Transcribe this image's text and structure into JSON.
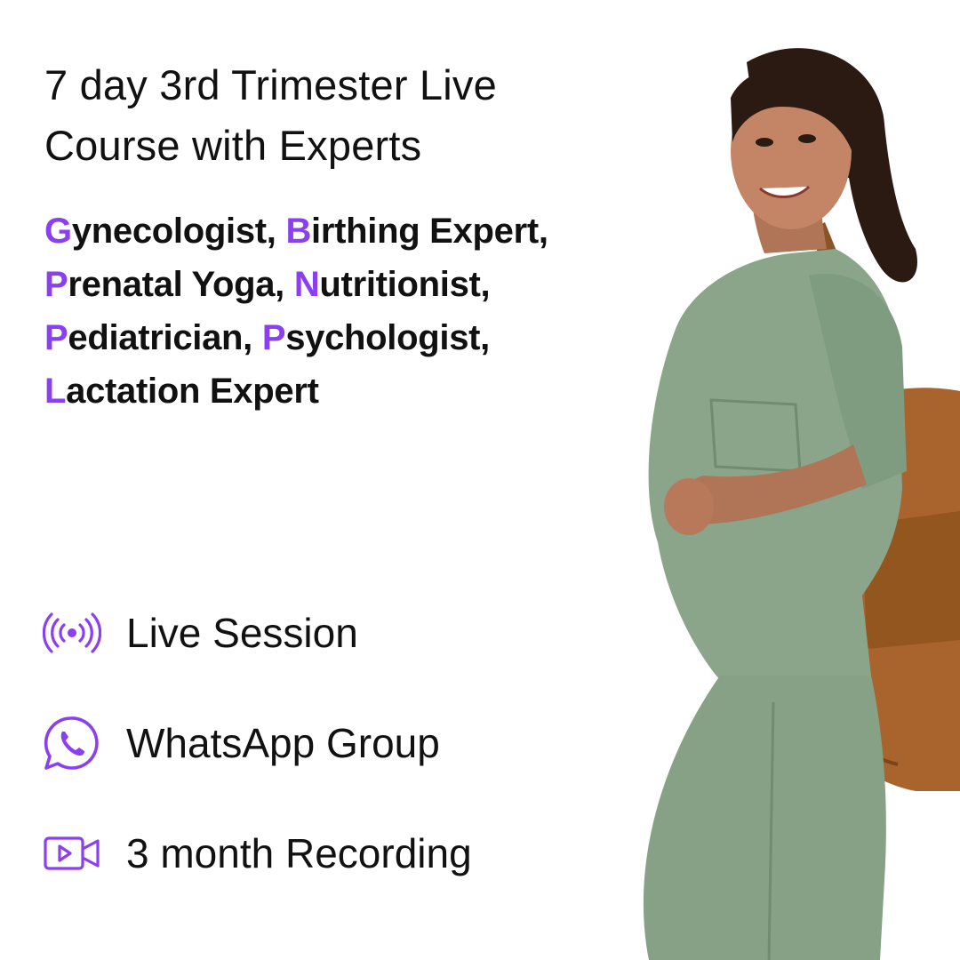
{
  "title": {
    "line1": "7 day 3rd Trimester Live",
    "line2": "Course with Experts"
  },
  "experts": [
    {
      "initial": "G",
      "rest": "ynecologist,"
    },
    {
      "initial": "B",
      "rest": "irthing Expert,"
    },
    {
      "initial": "P",
      "rest": "renatal Yoga,"
    },
    {
      "initial": "N",
      "rest": "utritionist,"
    },
    {
      "initial": "P",
      "rest": "ediatrician,"
    },
    {
      "initial": "P",
      "rest": "sychologist,"
    },
    {
      "initial": "L",
      "rest": "actation Expert"
    }
  ],
  "features": [
    {
      "label": "Live Session",
      "icon": "live-broadcast-icon"
    },
    {
      "label": "WhatsApp Group",
      "icon": "whatsapp-icon"
    },
    {
      "label": "3 month Recording",
      "icon": "video-camera-icon"
    }
  ],
  "colors": {
    "accent": "#8a3ff0",
    "text": "#111111",
    "background": "#ffffff",
    "scrubs": "#8aa58a",
    "backpack": "#a8642c"
  }
}
